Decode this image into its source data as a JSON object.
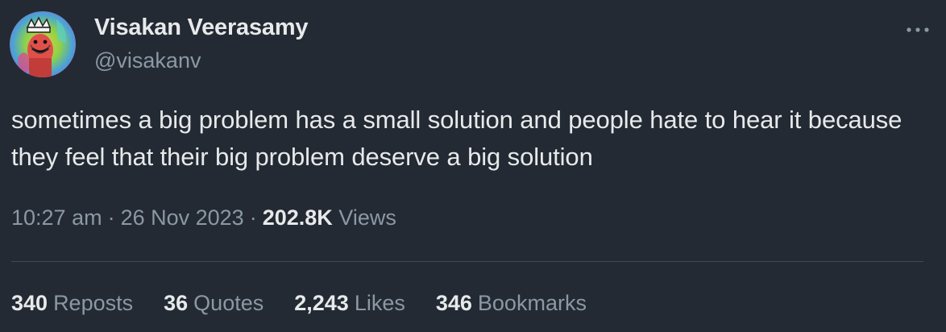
{
  "author": {
    "display_name": "Visakan Veerasamy",
    "handle": "@visakanv",
    "avatar_icon": "crowned-figure-avatar-icon"
  },
  "more_icon": "ellipsis-icon",
  "tweet": {
    "text": "sometimes a big problem has a small solution and people hate to hear it because they feel that their big problem deserve a big solution"
  },
  "meta": {
    "time": "10:27 am",
    "separator": "·",
    "date": "26 Nov 2023",
    "views_count": "202.8K",
    "views_label": "Views"
  },
  "stats": [
    {
      "count": "340",
      "label": "Reposts"
    },
    {
      "count": "36",
      "label": "Quotes"
    },
    {
      "count": "2,243",
      "label": "Likes"
    },
    {
      "count": "346",
      "label": "Bookmarks"
    }
  ],
  "colors": {
    "background": "#232a33",
    "primary_text": "#e7e9ea",
    "secondary_text": "#8b98a5",
    "divider": "#3e4a57"
  }
}
